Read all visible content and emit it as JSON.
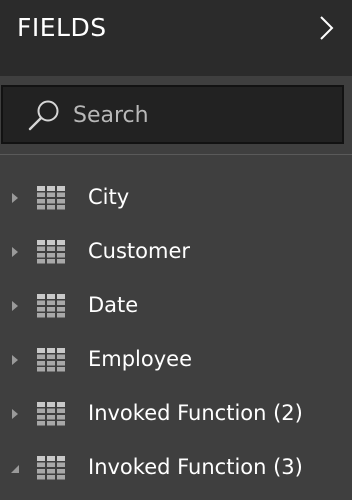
{
  "header": {
    "title": "FIELDS",
    "collapse_icon": "chevron-right-icon"
  },
  "search": {
    "icon": "search-icon",
    "placeholder": "Search",
    "value": ""
  },
  "fields": [
    {
      "label": "City",
      "expanded": false,
      "icon": "table-icon"
    },
    {
      "label": "Customer",
      "expanded": false,
      "icon": "table-icon"
    },
    {
      "label": "Date",
      "expanded": false,
      "icon": "table-icon"
    },
    {
      "label": "Employee",
      "expanded": false,
      "icon": "table-icon"
    },
    {
      "label": "Invoked Function (2)",
      "expanded": false,
      "icon": "table-icon"
    },
    {
      "label": "Invoked Function (3)",
      "expanded": true,
      "icon": "table-icon"
    }
  ],
  "colors": {
    "header_bg": "#2b2b2b",
    "pane_bg": "#3f3f3f",
    "search_bg": "#222222",
    "text": "#ffffff",
    "icon_gray": "#9a9a9a"
  }
}
